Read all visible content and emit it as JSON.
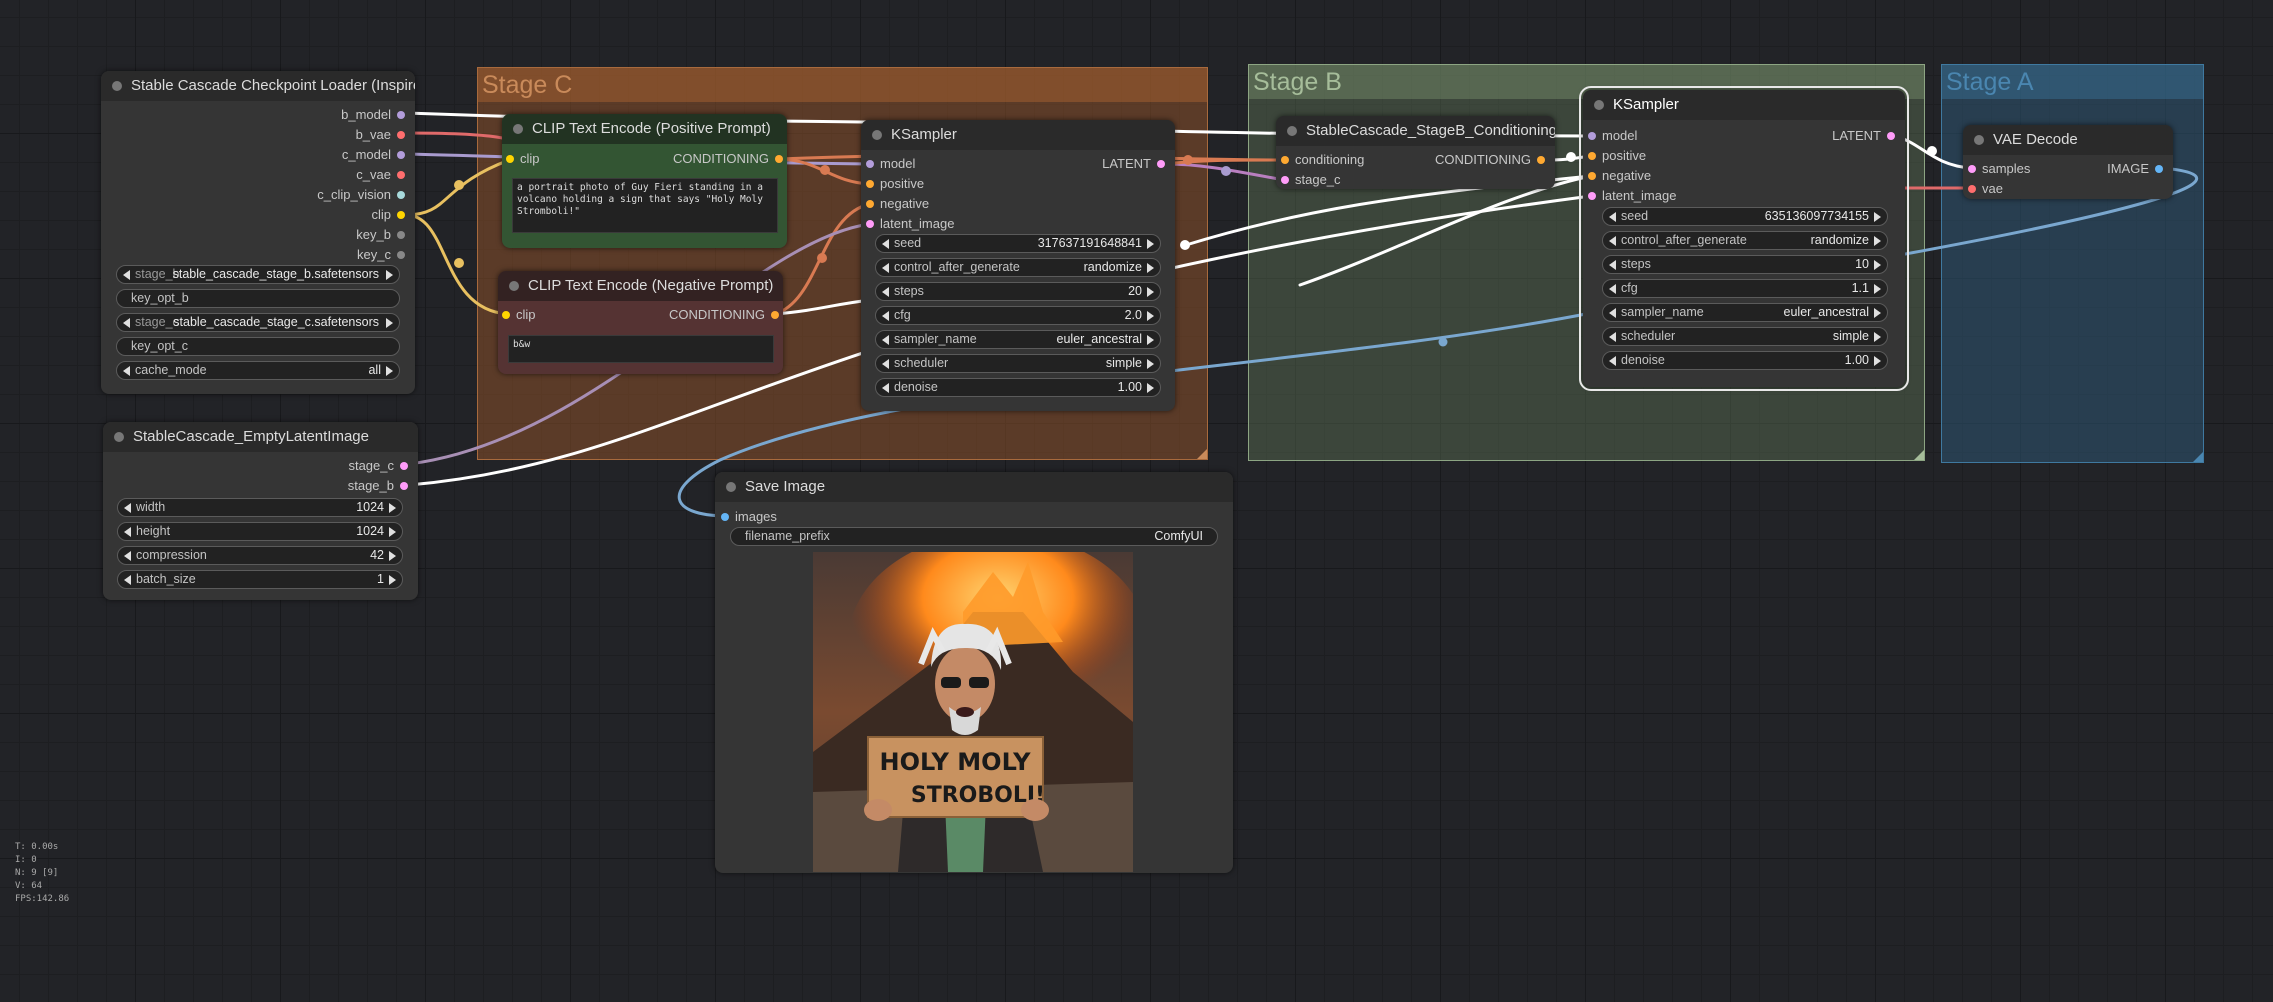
{
  "groups": {
    "stage_c": {
      "title": "Stage C",
      "color": "#b06634"
    },
    "stage_b": {
      "title": "Stage B",
      "color": "#8aa17c"
    },
    "stage_a": {
      "title": "Stage A",
      "color": "#3f79a0"
    }
  },
  "checkpoint_loader": {
    "title": "Stable Cascade Checkpoint Loader (Inspire)",
    "outputs": [
      "b_model",
      "b_vae",
      "c_model",
      "c_vae",
      "c_clip_vision",
      "clip",
      "key_b",
      "key_c"
    ],
    "stage_b_label": "stage_b",
    "stage_b_value": "stable_cascade_stage_b.safetensors",
    "key_opt_b": "key_opt_b",
    "stage_c_label": "stage_c",
    "stage_c_value": "stable_cascade_stage_c.safetensors",
    "key_opt_c": "key_opt_c",
    "cache_mode_label": "cache_mode",
    "cache_mode_value": "all"
  },
  "clip_positive": {
    "title": "CLIP Text Encode (Positive Prompt)",
    "input": "clip",
    "output": "CONDITIONING",
    "text": "a portrait photo of Guy Fieri standing in a volcano holding a sign that says \"Holy Moly Stromboli!\""
  },
  "clip_negative": {
    "title": "CLIP Text Encode (Negative Prompt)",
    "input": "clip",
    "output": "CONDITIONING",
    "text": "b&w"
  },
  "ksampler_c": {
    "title": "KSampler",
    "inputs": [
      "model",
      "positive",
      "negative",
      "latent_image"
    ],
    "output": "LATENT",
    "widgets": [
      {
        "label": "seed",
        "value": "317637191648841"
      },
      {
        "label": "control_after_generate",
        "value": "randomize"
      },
      {
        "label": "steps",
        "value": "20"
      },
      {
        "label": "cfg",
        "value": "2.0"
      },
      {
        "label": "sampler_name",
        "value": "euler_ancestral"
      },
      {
        "label": "scheduler",
        "value": "simple"
      },
      {
        "label": "denoise",
        "value": "1.00"
      }
    ]
  },
  "stage_b_cond": {
    "title": "StableCascade_StageB_Conditioning",
    "inputs": [
      "conditioning",
      "stage_c"
    ],
    "output": "CONDITIONING"
  },
  "ksampler_b": {
    "title": "KSampler",
    "inputs": [
      "model",
      "positive",
      "negative",
      "latent_image"
    ],
    "output": "LATENT",
    "widgets": [
      {
        "label": "seed",
        "value": "635136097734155"
      },
      {
        "label": "control_after_generate",
        "value": "randomize"
      },
      {
        "label": "steps",
        "value": "10"
      },
      {
        "label": "cfg",
        "value": "1.1"
      },
      {
        "label": "sampler_name",
        "value": "euler_ancestral"
      },
      {
        "label": "scheduler",
        "value": "simple"
      },
      {
        "label": "denoise",
        "value": "1.00"
      }
    ]
  },
  "vae_decode": {
    "title": "VAE Decode",
    "inputs": [
      "samples",
      "vae"
    ],
    "output": "IMAGE"
  },
  "empty_latent": {
    "title": "StableCascade_EmptyLatentImage",
    "outputs": [
      "stage_c",
      "stage_b"
    ],
    "widgets": [
      {
        "label": "width",
        "value": "1024"
      },
      {
        "label": "height",
        "value": "1024"
      },
      {
        "label": "compression",
        "value": "42"
      },
      {
        "label": "batch_size",
        "value": "1"
      }
    ]
  },
  "save_image": {
    "title": "Save Image",
    "input": "images",
    "filename_label": "filename_prefix",
    "filename_value": "ComfyUI",
    "sign_line1": "HOLY MOLY",
    "sign_line2": "STROBOLI!"
  },
  "stats": {
    "t": "T: 0.00s",
    "i": "I: 0",
    "n": "N: 9 [9]",
    "v": "V: 64",
    "fps": "FPS:142.86"
  },
  "slot_colors": {
    "model": "#b39ddb",
    "vae": "#ff6e6e",
    "clip": "#ffd500",
    "clip_vision": "#a8dadc",
    "conditioning": "#ffa931",
    "latent": "#ff9cf9",
    "image": "#64b5f6",
    "other": "#888888"
  }
}
